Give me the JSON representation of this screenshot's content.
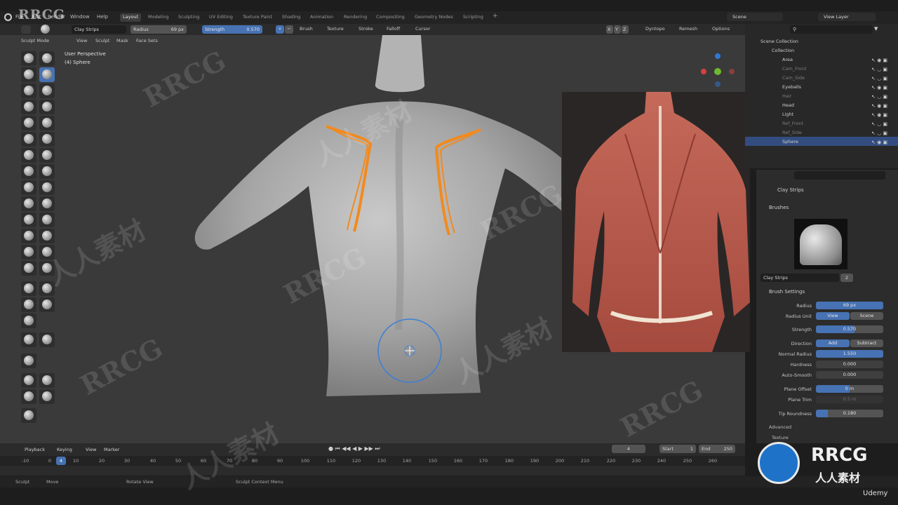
{
  "menu": {
    "items": [
      "File",
      "Edit",
      "Render",
      "Window",
      "Help"
    ],
    "watermark_logo": "RRCG"
  },
  "workspace_tabs": [
    "Layout",
    "Modeling",
    "Sculpting",
    "UV Editing",
    "Texture Paint",
    "Shading",
    "Animation",
    "Rendering",
    "Compositing",
    "Geometry Nodes",
    "Scripting"
  ],
  "active_tab": "Layout",
  "scene": {
    "name": "Scene",
    "view_layer": "View Layer"
  },
  "tool_header": {
    "brush_name": "Clay Strips",
    "radius_label": "Radius",
    "radius_value": "69 px",
    "strength_label": "Strength",
    "strength_value": "0.570",
    "menus": [
      "Brush",
      "Texture",
      "Stroke",
      "Falloff",
      "Cursor"
    ],
    "axes": [
      "X",
      "Y",
      "Z"
    ],
    "right_menus": [
      "Dyntopo",
      "Remesh",
      "Options"
    ]
  },
  "mode_header": {
    "mode": "Sculpt Mode",
    "menus": [
      "View",
      "Sculpt",
      "Mask",
      "Face Sets"
    ]
  },
  "viewport": {
    "perspective": "User Perspective",
    "object": "(4) Sphere"
  },
  "outliner": {
    "root": "Scene Collection",
    "collection": "Collection",
    "items": [
      {
        "name": "Area",
        "dim": false,
        "selected": false
      },
      {
        "name": "Cam_Front",
        "dim": true,
        "selected": false
      },
      {
        "name": "Cam_Side",
        "dim": true,
        "selected": false
      },
      {
        "name": "Eyeballs",
        "dim": false,
        "selected": false
      },
      {
        "name": "Hair",
        "dim": true,
        "selected": false
      },
      {
        "name": "Head",
        "dim": false,
        "selected": false
      },
      {
        "name": "Light",
        "dim": false,
        "selected": false
      },
      {
        "name": "Ref_Front",
        "dim": true,
        "selected": false
      },
      {
        "name": "Ref_Side",
        "dim": true,
        "selected": false
      },
      {
        "name": "Sphere",
        "dim": false,
        "selected": true
      }
    ]
  },
  "properties": {
    "brush_label": "Clay Strips",
    "brushes_header": "Brushes",
    "brush_slot_name": "Clay Strips",
    "brush_users": "2",
    "settings_header": "Brush Settings",
    "rows": [
      {
        "label": "Radius",
        "value": "69 px",
        "fill": 1.0
      },
      {
        "label": "Radius Unit",
        "value": "View",
        "value2": "Scene"
      },
      {
        "label": "Strength",
        "value": "0.570",
        "fill": 0.57
      },
      {
        "label": "Direction",
        "value": "Add",
        "value2": "Subtract"
      },
      {
        "label": "Normal Radius",
        "value": "1.550",
        "fill": 1.0
      },
      {
        "label": "Hardness",
        "value": "0.000",
        "fill": 0
      },
      {
        "label": "Auto-Smooth",
        "value": "0.000",
        "fill": 0
      },
      {
        "label": "Plane Offset",
        "value": "0 m",
        "fill": 0.5
      },
      {
        "label": "Plane Trim",
        "value": "0.5 m",
        "fill": 0
      },
      {
        "label": "Tip Roundness",
        "value": "0.180",
        "fill": 0.18
      }
    ],
    "advanced": "Advanced",
    "texture": "Texture"
  },
  "timeline": {
    "menus": [
      "Playback",
      "Keying",
      "View",
      "Marker"
    ],
    "current_frame": "4",
    "start_label": "Start",
    "start": "1",
    "end_label": "End",
    "end": "250",
    "ticks": [
      "-10",
      "0",
      "4",
      "10",
      "20",
      "30",
      "40",
      "50",
      "60",
      "70",
      "80",
      "90",
      "100",
      "110",
      "120",
      "130",
      "140",
      "150",
      "160",
      "170",
      "180",
      "190",
      "200",
      "210",
      "220",
      "230",
      "240",
      "250",
      "260"
    ]
  },
  "status_bar": {
    "items": [
      "Sculpt",
      "Move",
      "Rotate View",
      "Sculpt Context Menu"
    ]
  },
  "watermarks": {
    "brand": "RRCG",
    "cn": "人人素材",
    "platform": "Udemy"
  },
  "colors": {
    "accent": "#4772b3",
    "selected_row": "#334d80",
    "stroke": "#f28a1e",
    "brush_circle": "#3d7fd6"
  }
}
